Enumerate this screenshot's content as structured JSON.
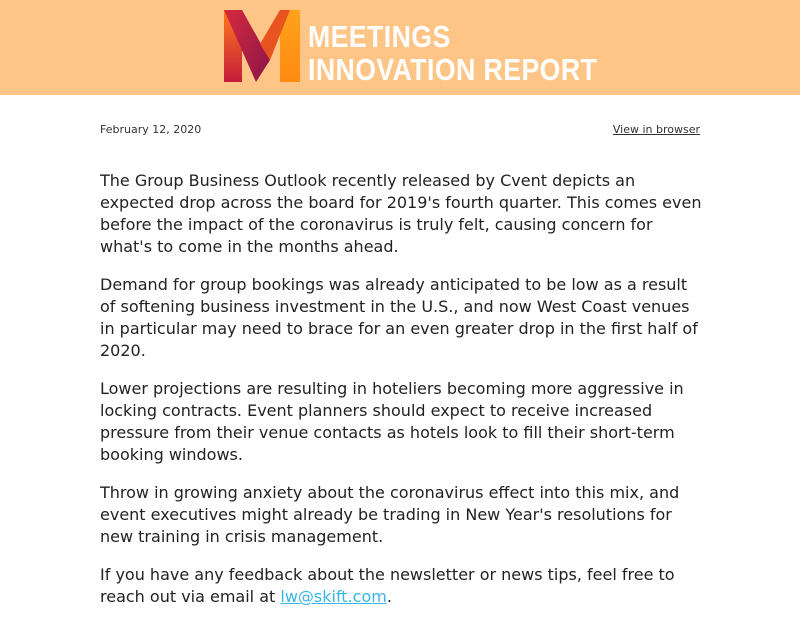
{
  "header": {
    "logo_line1": "MEETINGS",
    "logo_line2": "INNOVATION REPORT",
    "bg_color": "#ffc586"
  },
  "meta": {
    "date": "February 12, 2020",
    "view_link": "View in browser"
  },
  "body": {
    "p1": [
      "The Group Business Outlook recently released by Cvent depicts an",
      "expected drop across the board for 2019's fourth quarter. This comes even",
      "before the impact of the coronavirus is truly felt, causing concern for",
      "what's to come in the months ahead."
    ],
    "p2": [
      "Demand for group bookings was already anticipated to be low as a result",
      "of softening business investment in the U.S., and now West Coast venues",
      "in particular may need to brace for an even greater drop in the first half of",
      "2020."
    ],
    "p3": [
      "Lower projections are resulting in hoteliers becoming more aggressive in",
      "locking contracts. Event planners should expect to receive increased",
      "pressure from their venue contacts as hotels look to fill their short-term",
      "booking windows."
    ],
    "p4": [
      "Throw in growing anxiety about the coronavirus effect into this mix, and",
      "event executives might already be trading in New Year's resolutions for",
      "new training in crisis management."
    ],
    "p5_line1": "If you have any feedback about the newsletter or news tips, feel free to",
    "p5_line2_prefix": "reach out via email at ",
    "p5_email": "lw@skift.com",
    "p5_line2_suffix": "."
  },
  "colors": {
    "link": "#38b7e6",
    "text": "#222222"
  }
}
